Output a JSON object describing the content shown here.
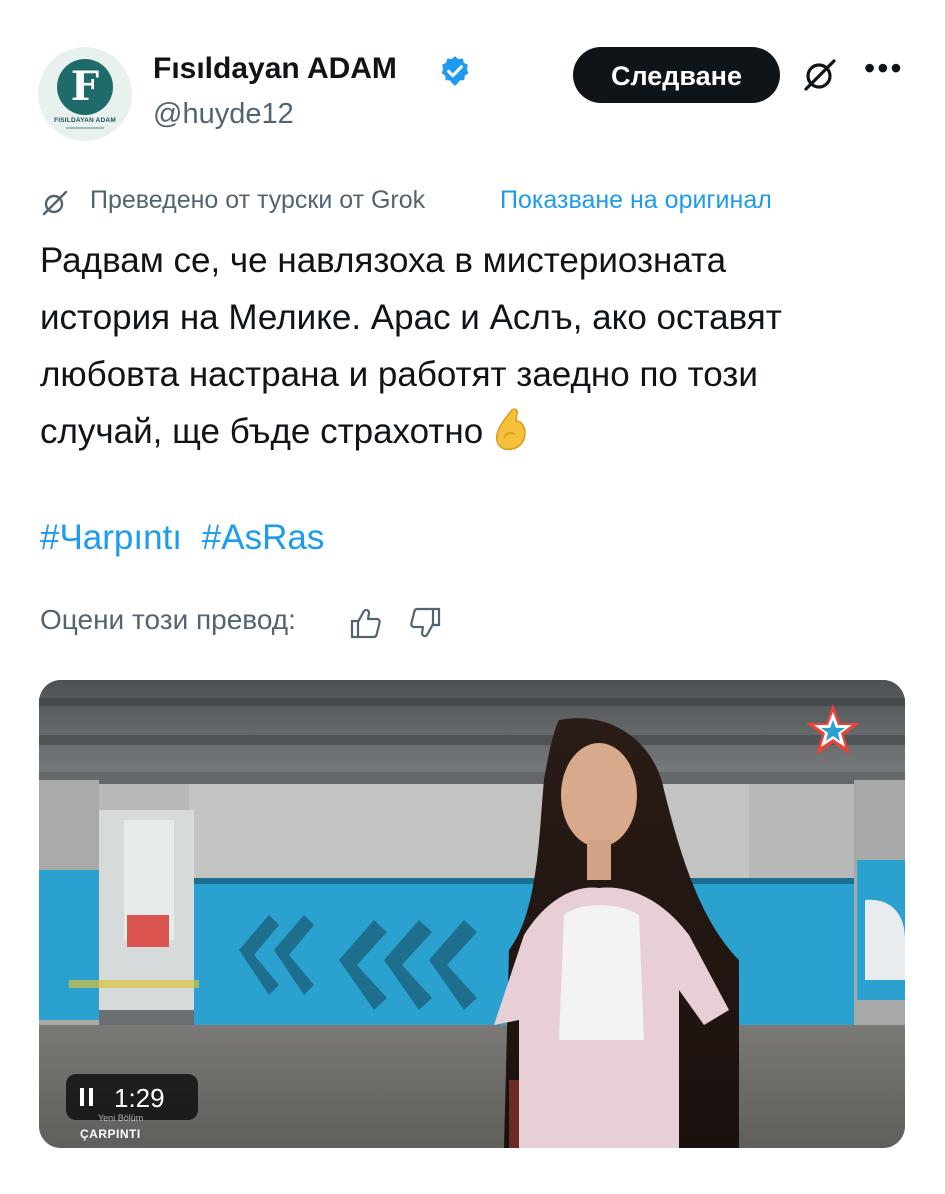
{
  "account": {
    "display_name": "Fısıldayan ADAM",
    "handle": "@huyde12",
    "verified": true,
    "avatar_letter": "F",
    "avatar_caption": "FISILDAYAN ADAM"
  },
  "actions": {
    "follow_label": "Следване",
    "grok_icon": "grok-icon",
    "more_icon": "more-icon"
  },
  "translation": {
    "note": "Преведено от турски от Grok",
    "show_original": "Показване на оригинал"
  },
  "tweet": {
    "lines": [
      "Радвам се, че навлязоха в мистериозната",
      "история на Мелике. Арас и Аслъ, ако оставят",
      "любовта настрана и работят заедно по този",
      "случай, ще бъде страхотно"
    ],
    "emoji": "pinched-fingers-emoji",
    "hashtags": [
      "#Чarpıntı",
      "#AsRas"
    ]
  },
  "rating": {
    "label": "Оцени този превод:"
  },
  "media": {
    "playback_time": "1:29",
    "watermark_small": "Yeni Bölüm",
    "watermark": "ÇARPINTI",
    "colors": {
      "wall_blue": "#2aa1cf",
      "ceiling": "#5b5e61",
      "floor": "#6e6d6a"
    }
  },
  "colors": {
    "link": "#1d9bf0",
    "muted": "#536471",
    "text": "#0f1419",
    "verified": "#1d9bf0"
  }
}
